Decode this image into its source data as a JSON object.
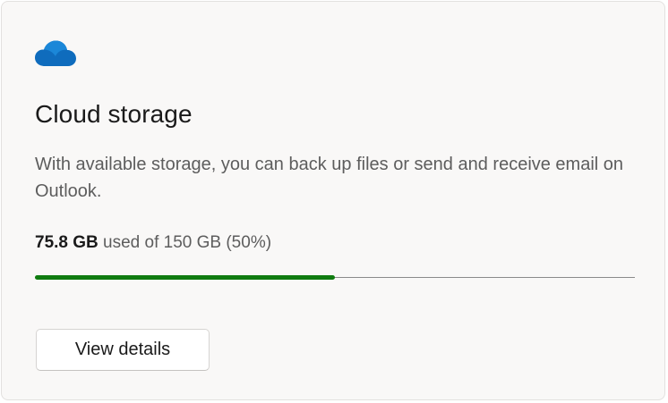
{
  "card": {
    "icon": "cloud-icon",
    "title": "Cloud storage",
    "description": "With available storage, you can back up files or send and receive email on Outlook.",
    "usage": {
      "used": "75.8 GB",
      "rest": " used of 150 GB (50%)",
      "fraction": 0.5
    },
    "button_label": "View details"
  },
  "colors": {
    "icon": "#0f6cbd",
    "progress_fill": "#107c10",
    "progress_track": "#8a8a8a"
  }
}
